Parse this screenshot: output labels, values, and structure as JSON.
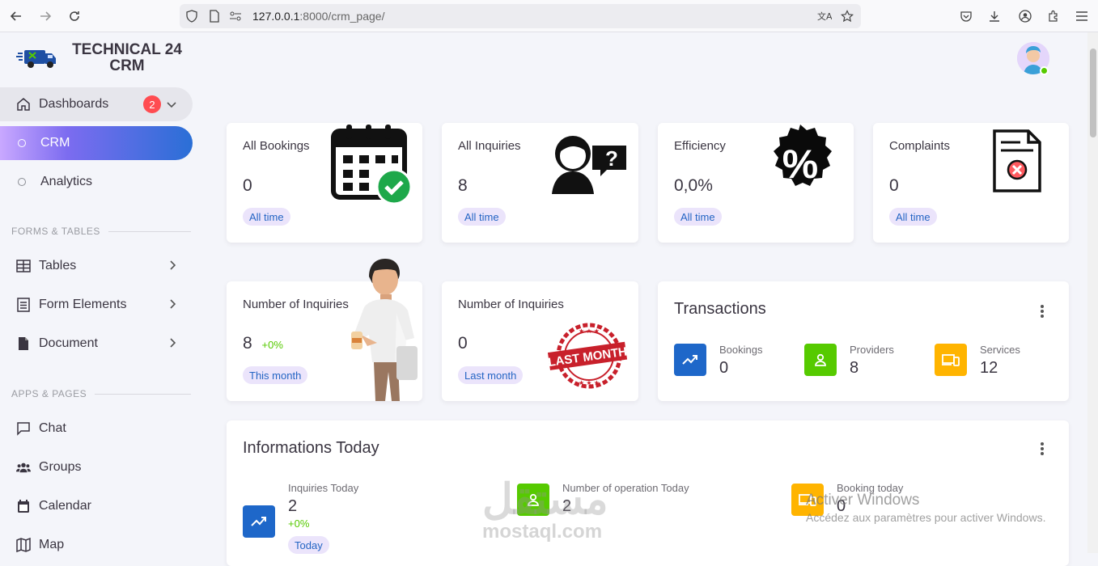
{
  "browser": {
    "url_host": "127.0.0.1",
    "url_path": ":8000/crm_page/"
  },
  "brand": {
    "line1": "TECHNICAL 24",
    "line2": "CRM"
  },
  "sidebar": {
    "dashboards": {
      "label": "Dashboards",
      "badge": "2"
    },
    "crm": "CRM",
    "analytics": "Analytics",
    "section_forms": "FORMS & TABLES",
    "tables": "Tables",
    "form_elements": "Form Elements",
    "document": "Document",
    "section_apps": "APPS & PAGES",
    "chat": "Chat",
    "groups": "Groups",
    "calendar": "Calendar",
    "map": "Map"
  },
  "cards": {
    "all_bookings": {
      "title": "All Bookings",
      "value": "0",
      "chip": "All time"
    },
    "all_inquiries": {
      "title": "All Inquiries",
      "value": "8",
      "chip": "All time"
    },
    "efficiency": {
      "title": "Efficiency",
      "value": "0,0%",
      "chip": "All time"
    },
    "complaints": {
      "title": "Complaints",
      "value": "0",
      "chip": "All time"
    },
    "inquiries_month": {
      "title": "Number of Inquiries",
      "value": "8",
      "growth": "+0%",
      "chip": "This month"
    },
    "inquiries_last": {
      "title": "Number of Inquiries",
      "value": "0",
      "chip": "Last month",
      "stamp": "LAST MONTH"
    }
  },
  "transactions": {
    "title": "Transactions",
    "items": [
      {
        "label": "Bookings",
        "value": "0",
        "color": "#1e67c9"
      },
      {
        "label": "Providers",
        "value": "8",
        "color": "#56ca00"
      },
      {
        "label": "Services",
        "value": "12",
        "color": "#ffb400"
      }
    ]
  },
  "informations": {
    "title": "Informations Today",
    "items": [
      {
        "label": "Inquiries Today",
        "value": "2",
        "growth": "+0%",
        "color": "#1e67c9"
      },
      {
        "label": "Number of operation Today",
        "value": "2",
        "color": "#56ca00"
      },
      {
        "label": "Booking today",
        "value": "0",
        "color": "#ffb400"
      }
    ],
    "chip": "Today"
  },
  "overlay": {
    "windows_title": "Activer Windows",
    "windows_sub": "Accédez aux paramètres pour activer Windows.",
    "logo_text": "mostaql.com"
  }
}
